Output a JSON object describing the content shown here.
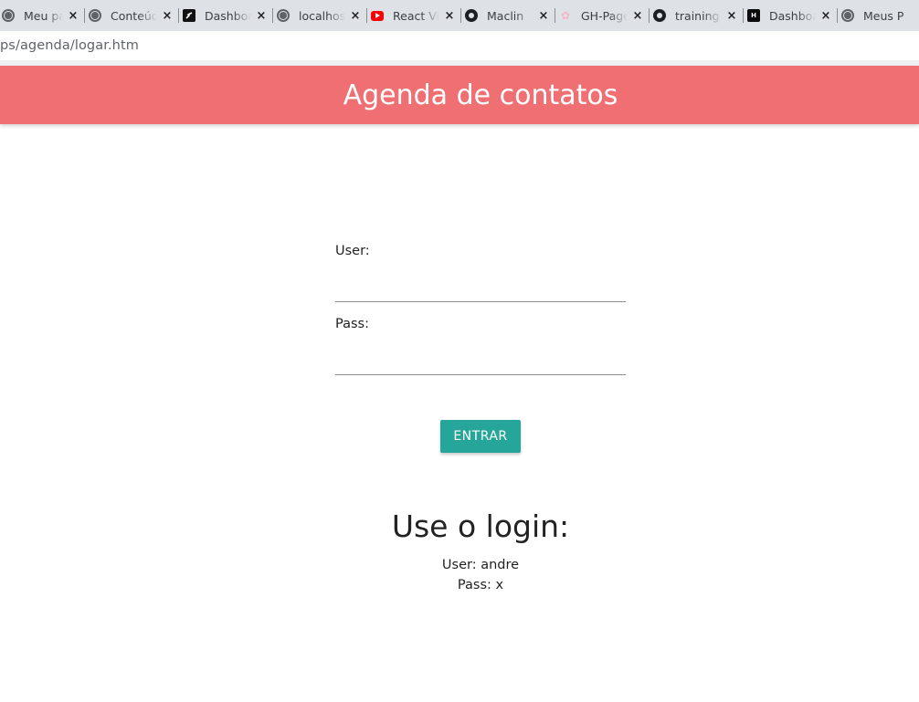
{
  "browser": {
    "tabs": [
      {
        "title": "Meu pai",
        "icon": "globe-icon"
      },
      {
        "title": "Conteúdo",
        "icon": "globe-icon"
      },
      {
        "title": "Dashboard",
        "icon": "app-logo-icon"
      },
      {
        "title": "localhost",
        "icon": "globe-icon"
      },
      {
        "title": "React Video",
        "icon": "youtube-icon"
      },
      {
        "title": "Maclin",
        "icon": "github-icon"
      },
      {
        "title": "GH-Pages",
        "icon": "pink-logo-icon"
      },
      {
        "title": "training",
        "icon": "github-icon"
      },
      {
        "title": "Dashboard",
        "icon": "hn-logo-icon"
      },
      {
        "title": "Meus P",
        "icon": "globe-icon"
      }
    ],
    "close_glyph": "×",
    "url": "ps/agenda/logar.htm"
  },
  "header": {
    "title": "Agenda de contatos",
    "color": "#ef6f73"
  },
  "form": {
    "user_label": "User:",
    "pass_label": "Pass:",
    "user_value": "",
    "pass_value": "",
    "submit_label": "ENTRAR",
    "submit_color": "#26a69a"
  },
  "hint": {
    "title": "Use o login:",
    "user_line": "User: andre",
    "pass_line": "Pass: x"
  }
}
